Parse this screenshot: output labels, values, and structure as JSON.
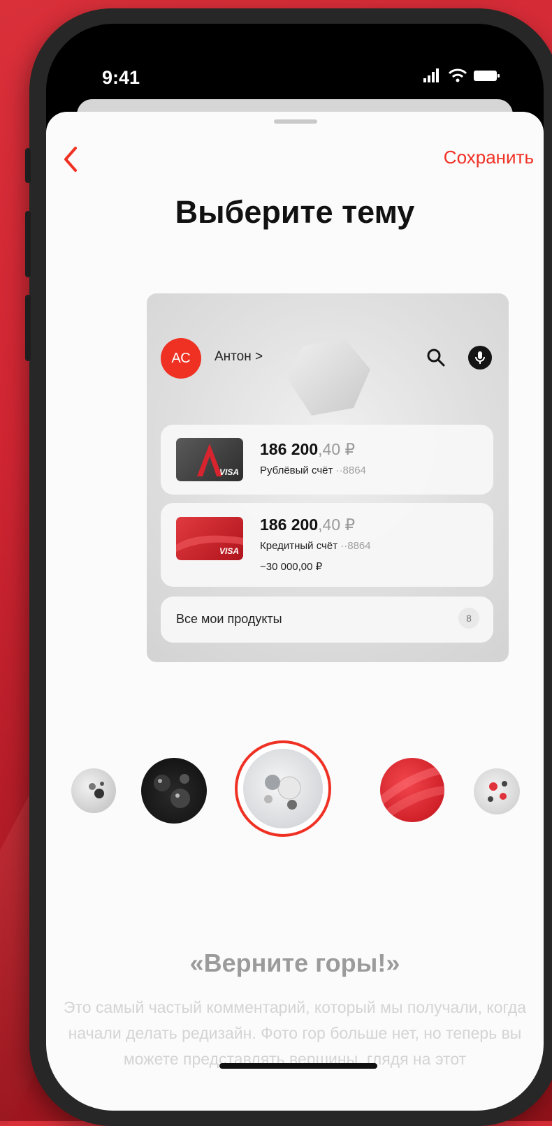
{
  "status_bar": {
    "time": "9:41"
  },
  "header": {
    "back_label": "‹",
    "save_label": "Сохранить",
    "title": "Выберите тему"
  },
  "preview": {
    "avatar_initials": "АС",
    "user_name": "Антон >",
    "accounts": [
      {
        "balance_main": "186 200",
        "balance_cents": ",40 ₽",
        "name": "Рублёвый счёт",
        "number": "··8864",
        "card_brand": "VISA"
      },
      {
        "balance_main": "186 200",
        "balance_cents": ",40 ₽",
        "name": "Кредитный счёт",
        "number": "··8864",
        "limit": "−30 000,00 ₽",
        "card_brand": "VISA"
      }
    ],
    "products_label": "Все мои продукты",
    "products_count": "8"
  },
  "themes": [
    {
      "id": "grey-spheres",
      "selected": false
    },
    {
      "id": "black-spheres",
      "selected": false
    },
    {
      "id": "white-ice",
      "selected": true
    },
    {
      "id": "red-waves",
      "selected": false
    },
    {
      "id": "red-white",
      "selected": false
    }
  ],
  "theme_info": {
    "name": "«Верните горы!»",
    "description": "Это самый частый комментарий, который мы получали, когда начали делать редизайн. Фото гор больше нет, но теперь вы можете представлять вершины, глядя на этот"
  },
  "colors": {
    "accent": "#ef3124",
    "background": "#cf2532"
  }
}
